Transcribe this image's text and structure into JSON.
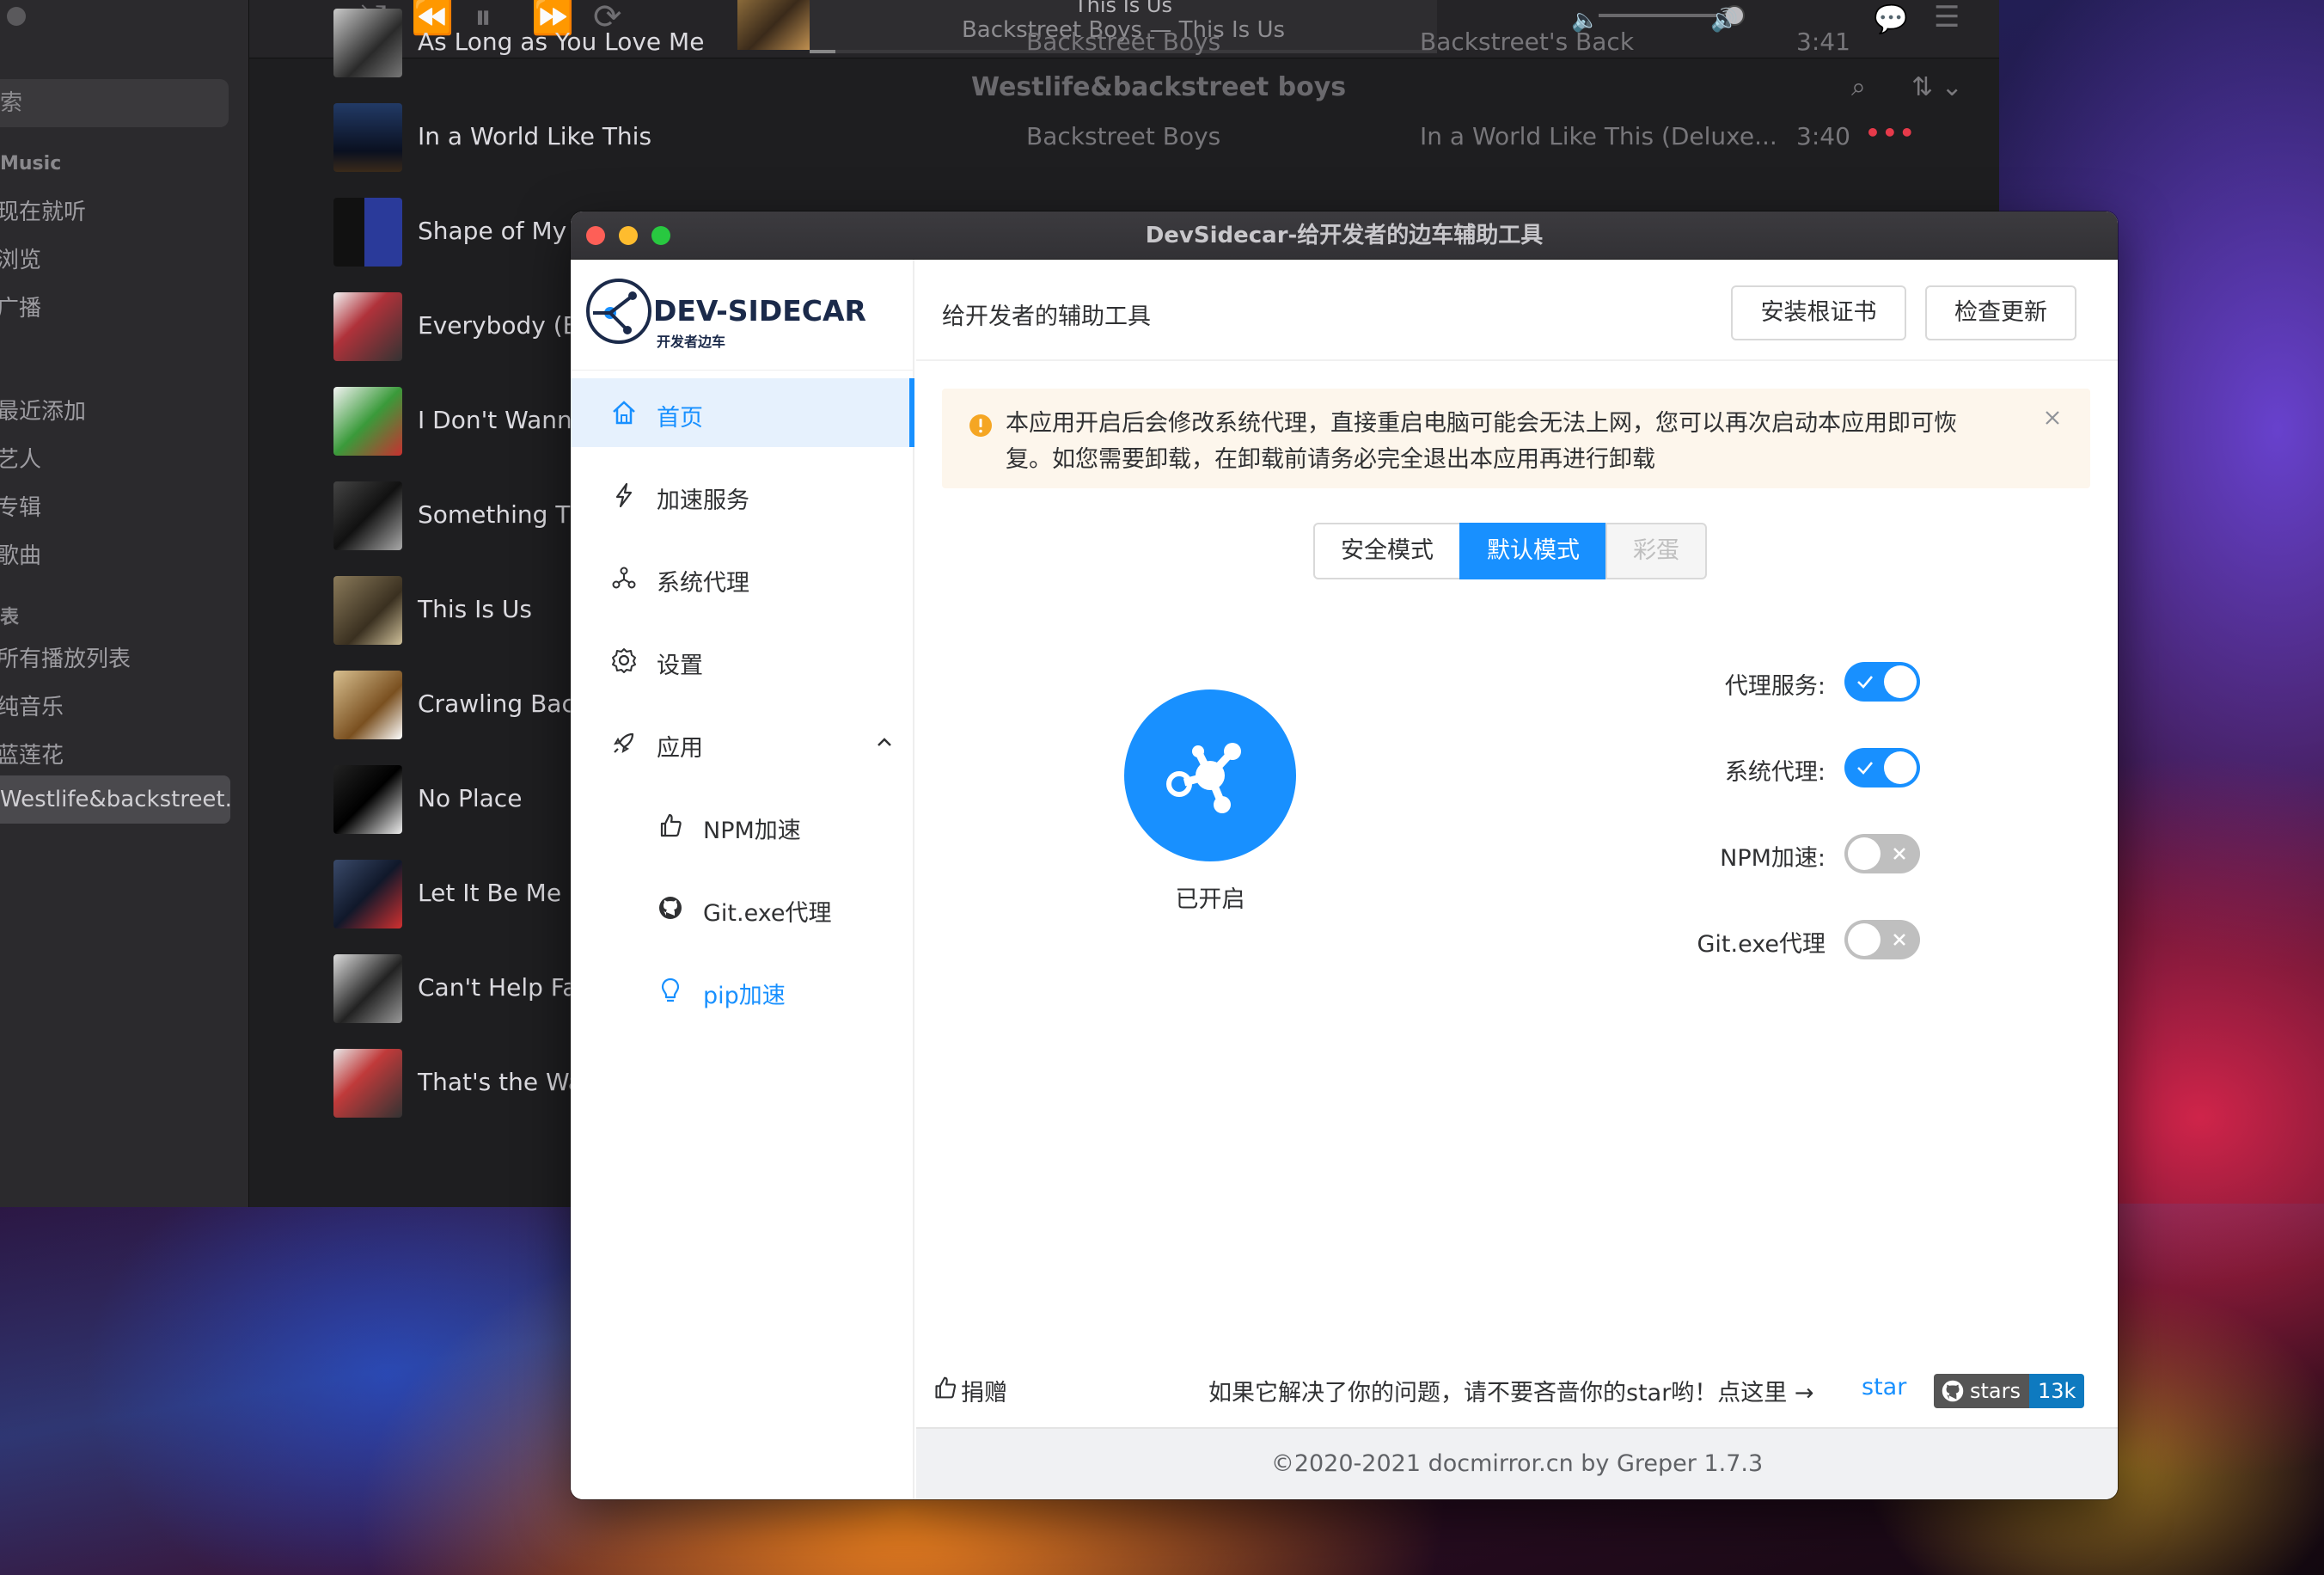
{
  "music": {
    "search_placeholder": "索",
    "section_music": "Music",
    "items_music": [
      "现在就听",
      "浏览",
      "广播"
    ],
    "items_library": [
      "最近添加",
      "艺人",
      "专辑",
      "歌曲"
    ],
    "section_playlists": "表",
    "items_playlists": [
      "所有播放列表",
      "纯音乐",
      "蓝莲花"
    ],
    "active_playlist": "Westlife&backstreet...",
    "now_playing_title": "This Is Us",
    "now_playing_sub": "Backstreet Boys — This Is Us",
    "playlist_heading": "Westlife&backstreet boys",
    "tracks": [
      {
        "name": "As Long as You Love Me",
        "artist": "Backstreet Boys",
        "album": "Backstreet's Back",
        "time": "3:41"
      },
      {
        "name": "In a World Like This",
        "artist": "Backstreet Boys",
        "album": "In a World Like This (Deluxe...",
        "time": "3:40"
      },
      {
        "name": "Shape of My H",
        "artist": "",
        "album": "",
        "time": ""
      },
      {
        "name": "Everybody (Ba",
        "artist": "",
        "album": "",
        "time": ""
      },
      {
        "name": "I Don't Wanna",
        "artist": "",
        "album": "",
        "time": ""
      },
      {
        "name": "Something Th",
        "artist": "",
        "album": "",
        "time": ""
      },
      {
        "name": "This Is Us",
        "artist": "",
        "album": "",
        "time": ""
      },
      {
        "name": "Crawling Back",
        "artist": "",
        "album": "",
        "time": ""
      },
      {
        "name": "No Place",
        "artist": "",
        "album": "",
        "time": ""
      },
      {
        "name": "Let It Be Me",
        "artist": "",
        "album": "",
        "time": ""
      },
      {
        "name": "Can't Help Fal",
        "artist": "",
        "album": "",
        "time": ""
      },
      {
        "name": "That's the Wa",
        "artist": "",
        "album": "",
        "time": ""
      }
    ],
    "more_dots": "•••"
  },
  "ds": {
    "window_title": "DevSidecar-给开发者的边车辅助工具",
    "logo_text": "DEV-SIDECAR",
    "logo_sub": "开发者边车",
    "nav": {
      "home": "首页",
      "accel": "加速服务",
      "proxy": "系统代理",
      "settings": "设置",
      "apps": "应用",
      "npm": "NPM加速",
      "git": "Git.exe代理",
      "pip": "pip加速"
    },
    "header_title": "给开发者的辅助工具",
    "btn_install_cert": "安装根证书",
    "btn_check_update": "检查更新",
    "alert_line1": "本应用开启后会修改系统代理，直接重启电脑可能会无法上网，您可以再次启动本应用即可恢",
    "alert_line2": "复。如您需要卸载，在卸载前请务必完全退出本应用再进行卸载",
    "modes": {
      "safe": "安全模式",
      "default": "默认模式",
      "egg": "彩蛋"
    },
    "power_label": "已开启",
    "switches": [
      {
        "label": "代理服务:",
        "on": true
      },
      {
        "label": "系统代理:",
        "on": true
      },
      {
        "label": "NPM加速:",
        "on": false
      },
      {
        "label": "Git.exe代理",
        "on": false
      }
    ],
    "donate": "捐赠",
    "star_text": "如果它解决了你的问题，请不要吝啬你的star哟！点这里 →",
    "broken_img_alt": "star",
    "gh_label": "stars",
    "gh_count": "13k",
    "footer": "©2020-2021 docmirror.cn by Greper 1.7.3"
  },
  "colors": {
    "accent": "#1890ff",
    "warning": "#fdf6ec",
    "warning_icon": "#f5a623"
  }
}
